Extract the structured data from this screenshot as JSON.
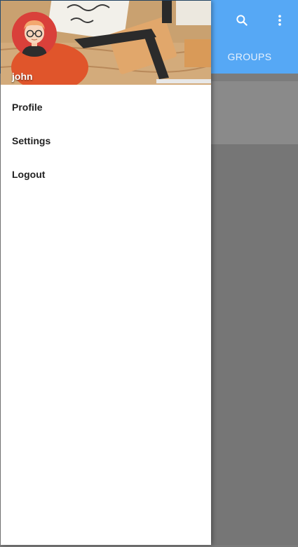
{
  "app": {
    "tab_label": "GROUPS",
    "toolbar_icons": [
      "search-icon",
      "more-vert-icon"
    ],
    "accent_color": "#56a8f5"
  },
  "drawer": {
    "username": "john",
    "menu": [
      {
        "label": "Profile"
      },
      {
        "label": "Settings"
      },
      {
        "label": "Logout"
      }
    ]
  }
}
